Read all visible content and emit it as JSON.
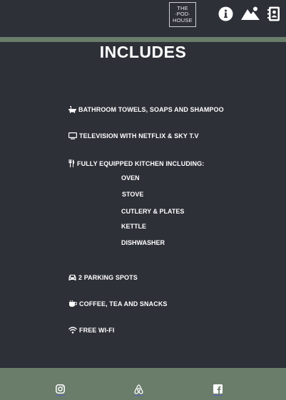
{
  "header": {
    "logo_lines": [
      "THE",
      "POD",
      "HOUSE"
    ],
    "icons": [
      "info-icon",
      "mountain-image-icon",
      "contact-book-icon"
    ]
  },
  "title": "INCLUDES",
  "amenities": [
    {
      "icon": "bath-icon",
      "label": "BATHROOM TOWELS, SOAPS AND SHAMPOO"
    },
    {
      "icon": "tv-icon",
      "label": "TELEVISION WITH NETFLIX & SKY T.V"
    },
    {
      "icon": "utensils-icon",
      "label": "FULLY EQUIPPED KITCHEN INCLUDING:"
    },
    {
      "icon": "car-icon",
      "label": "2 PARKING SPOTS"
    },
    {
      "icon": "coffee-icon",
      "label": "COFFEE, TEA AND SNACKS"
    },
    {
      "icon": "wifi-icon",
      "label": "FREE WI-FI"
    }
  ],
  "kitchen_items": [
    "OVEN",
    "STOVE",
    "CUTLERY & PLATES",
    "KETTLE",
    "DISHWASHER"
  ],
  "footer": {
    "icons": [
      "instagram-icon",
      "airbnb-icon",
      "facebook-icon"
    ]
  },
  "colors": {
    "background": "#2e3038",
    "accent": "#6a7d6b",
    "text": "#ffffff"
  }
}
